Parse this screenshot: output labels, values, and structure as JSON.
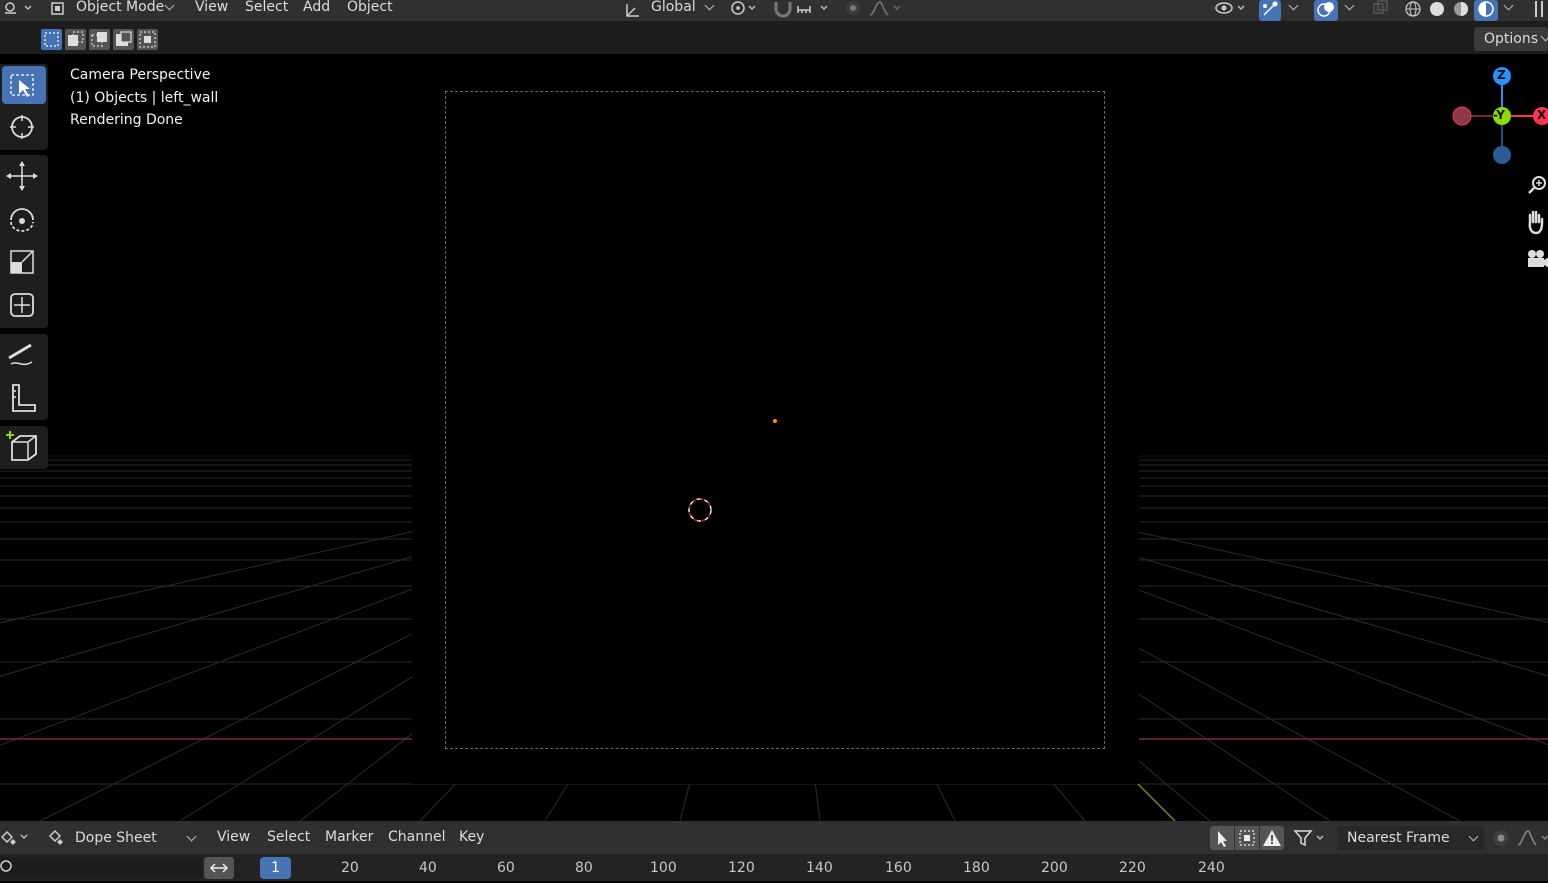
{
  "header": {
    "mode": "Object Mode",
    "menus": [
      "View",
      "Select",
      "Add",
      "Object"
    ],
    "transform_orientation": "Global"
  },
  "options_label": "Options",
  "viewport": {
    "overlay": {
      "view_name": "Camera Perspective",
      "collection_object": "(1) Objects | left_wall",
      "status": "Rendering Done"
    },
    "gizmo": {
      "z": "Z",
      "y": "-Y",
      "x": "X"
    }
  },
  "timeline": {
    "editor_type": "Dope Sheet",
    "menus": [
      "View",
      "Select",
      "Marker",
      "Channel",
      "Key"
    ],
    "snap_mode": "Nearest Frame",
    "current_frame": "1",
    "ticks": [
      "20",
      "40",
      "60",
      "80",
      "100",
      "120",
      "140",
      "160",
      "180",
      "200",
      "220",
      "240"
    ]
  },
  "colors": {
    "accent": "#4772b3",
    "header_bg": "#303030",
    "axis_x": "#ff3352",
    "axis_y": "#8bdc00",
    "axis_z": "#2890ff"
  }
}
